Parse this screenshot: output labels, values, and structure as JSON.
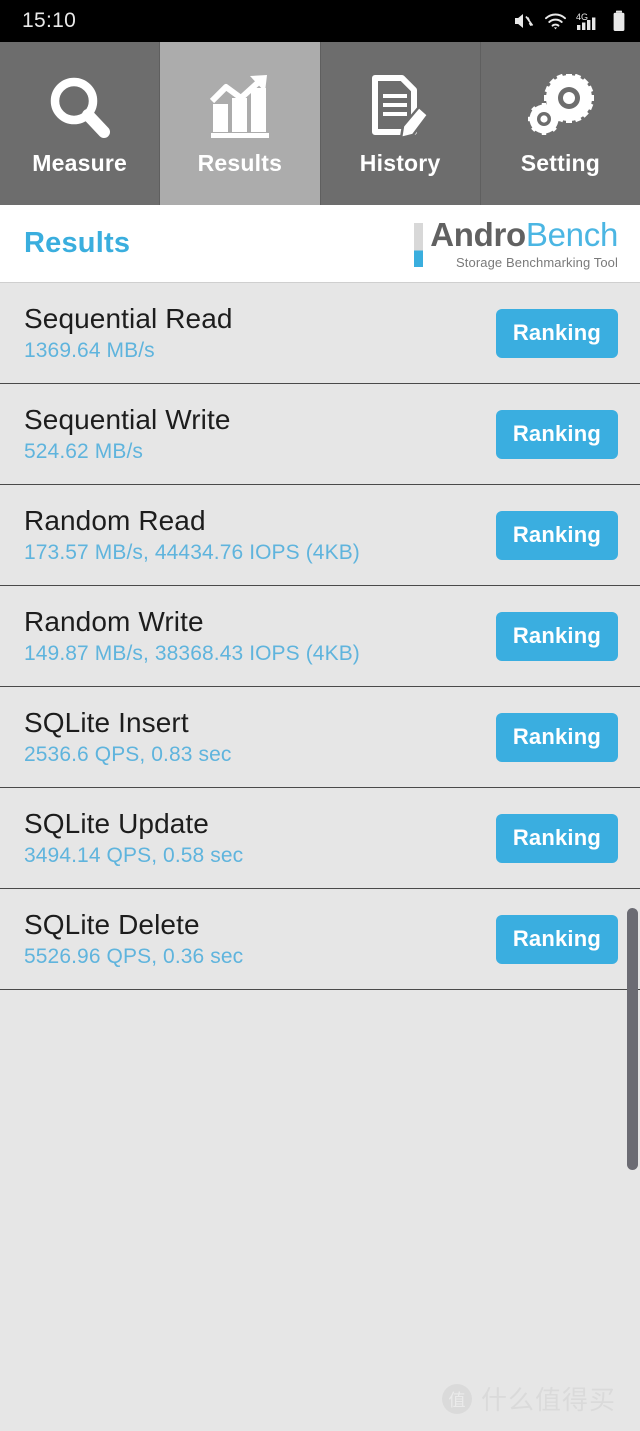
{
  "statusbar": {
    "time": "15:10",
    "icons": [
      "mute-icon",
      "wifi-icon",
      "4g-signal-icon",
      "battery-icon"
    ],
    "network_label": "4G"
  },
  "tabs": [
    {
      "id": "measure",
      "label": "Measure",
      "icon": "magnifier-icon",
      "active": false
    },
    {
      "id": "results",
      "label": "Results",
      "icon": "bar-chart-trend-icon",
      "active": true
    },
    {
      "id": "history",
      "label": "History",
      "icon": "document-pencil-icon",
      "active": false
    },
    {
      "id": "setting",
      "label": "Setting",
      "icon": "gears-icon",
      "active": false
    }
  ],
  "header": {
    "title": "Results",
    "logo_primary": "Andro",
    "logo_secondary": "Bench",
    "logo_tagline": "Storage Benchmarking Tool"
  },
  "results": {
    "ranking_label": "Ranking",
    "rows": [
      {
        "name": "Sequential Read",
        "value": "1369.64 MB/s"
      },
      {
        "name": "Sequential Write",
        "value": "524.62 MB/s"
      },
      {
        "name": "Random Read",
        "value": "173.57 MB/s, 44434.76 IOPS (4KB)"
      },
      {
        "name": "Random Write",
        "value": "149.87 MB/s, 38368.43 IOPS (4KB)"
      },
      {
        "name": "SQLite Insert",
        "value": "2536.6 QPS, 0.83 sec"
      },
      {
        "name": "SQLite Update",
        "value": "3494.14 QPS, 0.58 sec"
      },
      {
        "name": "SQLite Delete",
        "value": "5526.96 QPS, 0.36 sec"
      }
    ]
  },
  "watermark": {
    "badge": "值",
    "text": "什么值得买"
  },
  "colors": {
    "accent_blue": "#3aaee0",
    "value_blue": "#5fb4dd",
    "tabbar_gray": "#6d6d6d",
    "tab_active_gray": "#acacac",
    "page_bg": "#e6e6e6"
  }
}
